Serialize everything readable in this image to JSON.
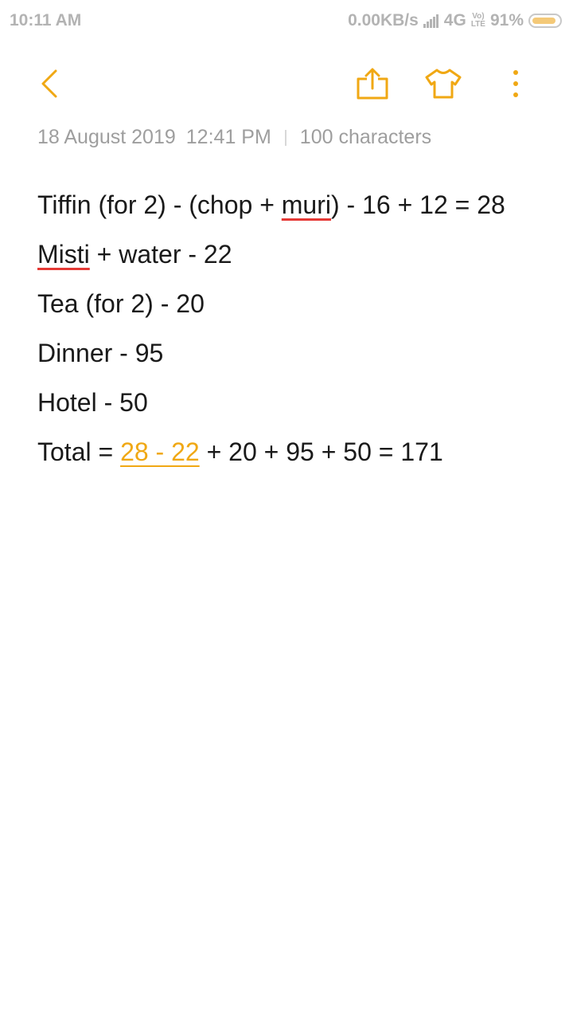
{
  "status_bar": {
    "time": "10:11 AM",
    "network_speed": "0.00KB/s",
    "network_type": "4G",
    "volte_top": "Vo)",
    "volte_bottom": "LTE",
    "battery_percent": "91%",
    "battery_level": 0.91,
    "icons": [
      "signal-icon",
      "volte-icon",
      "battery-icon"
    ]
  },
  "toolbar": {
    "icons": [
      "back-arrow-icon",
      "share-icon",
      "theme-shirt-icon",
      "more-options-icon"
    ],
    "accent_color": "#f0a814"
  },
  "note": {
    "date": "18 August 2019",
    "time": "12:41 PM",
    "char_count": "100 characters",
    "lines": [
      {
        "a": "Tiffin (for 2) - (chop + ",
        "b": "muri",
        "c": ") - 16 + 12 = 28"
      },
      {
        "a": "Misti",
        "b": " + water - 22"
      },
      {
        "text": "Tea (for 2) - 20"
      },
      {
        "text": "Dinner - 95"
      },
      {
        "text": "Hotel - 50"
      },
      {
        "a": "Total = ",
        "b": "28 - 22",
        "c": " + 20 + 95 + 50 = 171"
      }
    ],
    "colors": {
      "spellcheck": "#e53935",
      "link": "#f0a814",
      "text": "#1a1a1a",
      "meta": "#9e9e9e"
    }
  }
}
